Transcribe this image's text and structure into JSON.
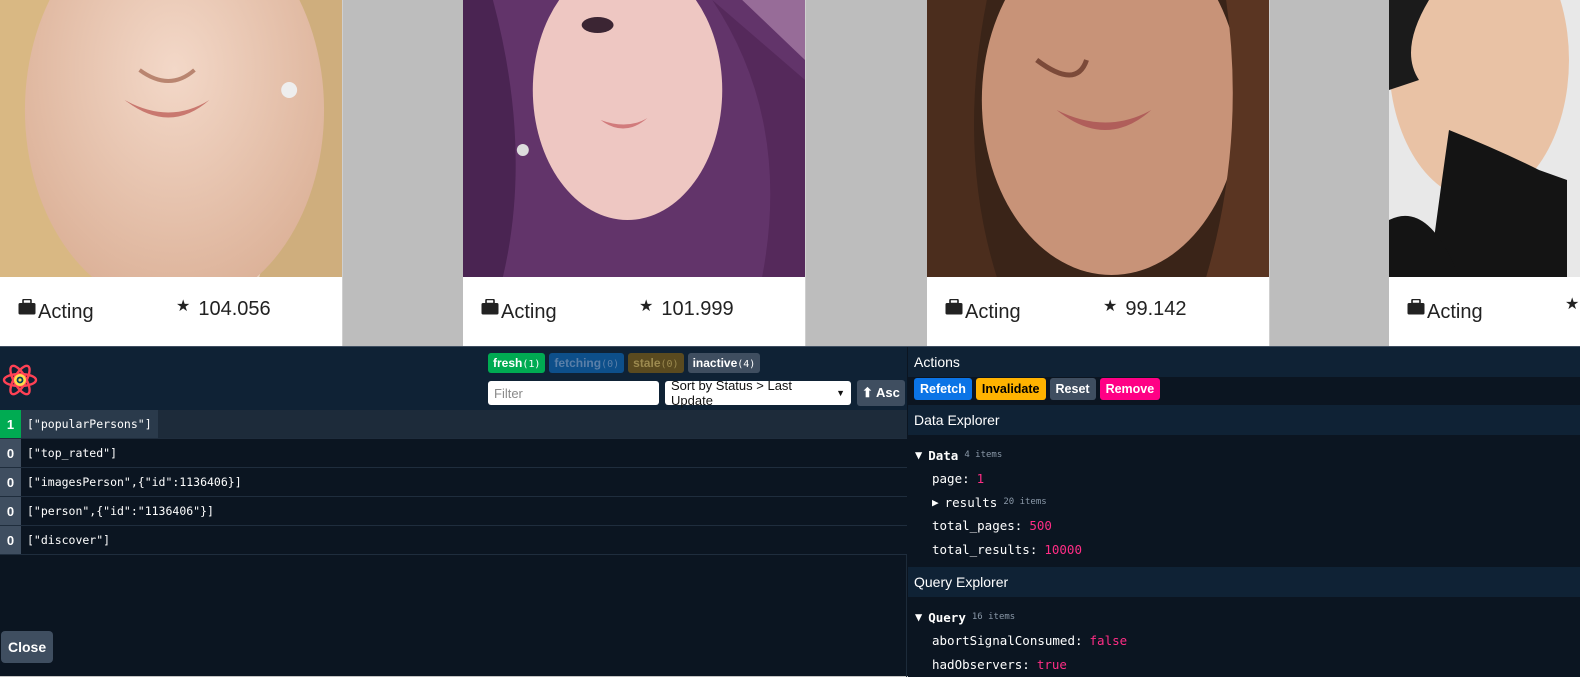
{
  "cards": [
    {
      "department": "Acting",
      "popularity": "104.056"
    },
    {
      "department": "Acting",
      "popularity": "101.999"
    },
    {
      "department": "Acting",
      "popularity": "99.142"
    },
    {
      "department": "Acting",
      "popularity": ""
    }
  ],
  "devtools": {
    "status": {
      "fresh": {
        "label": "fresh",
        "count": "(1)"
      },
      "fetching": {
        "label": "fetching",
        "count": "(0)"
      },
      "stale": {
        "label": "stale",
        "count": "(0)"
      },
      "inactive": {
        "label": "inactive",
        "count": "(4)"
      }
    },
    "filter_placeholder": "Filter",
    "sort_label": "Sort by Status > Last Update",
    "asc_label": "⬆ Asc",
    "queries": [
      {
        "observers": "1",
        "key": "[\"popularPersons\"]",
        "active": true
      },
      {
        "observers": "0",
        "key": "[\"top_rated\"]",
        "active": false
      },
      {
        "observers": "0",
        "key": "[\"imagesPerson\",{\"id\":1136406}]",
        "active": false
      },
      {
        "observers": "0",
        "key": "[\"person\",{\"id\":\"1136406\"}]",
        "active": false
      },
      {
        "observers": "0",
        "key": "[\"discover\"]",
        "active": false
      }
    ],
    "close_label": "Close",
    "actions": {
      "title": "Actions",
      "refetch": "Refetch",
      "invalidate": "Invalidate",
      "reset": "Reset",
      "remove": "Remove"
    },
    "data_explorer": {
      "title": "Data Explorer",
      "root_label": "Data",
      "root_count": "4 items",
      "page_key": "page:",
      "page_val": "1",
      "results_key": "results",
      "results_count": "20 items",
      "total_pages_key": "total_pages:",
      "total_pages_val": "500",
      "total_results_key": "total_results:",
      "total_results_val": "10000"
    },
    "query_explorer": {
      "title": "Query Explorer",
      "root_label": "Query",
      "root_count": "16 items",
      "abort_key": "abortSignalConsumed:",
      "abort_val": "false",
      "observers_key": "hadObservers:",
      "observers_val": "true"
    }
  }
}
